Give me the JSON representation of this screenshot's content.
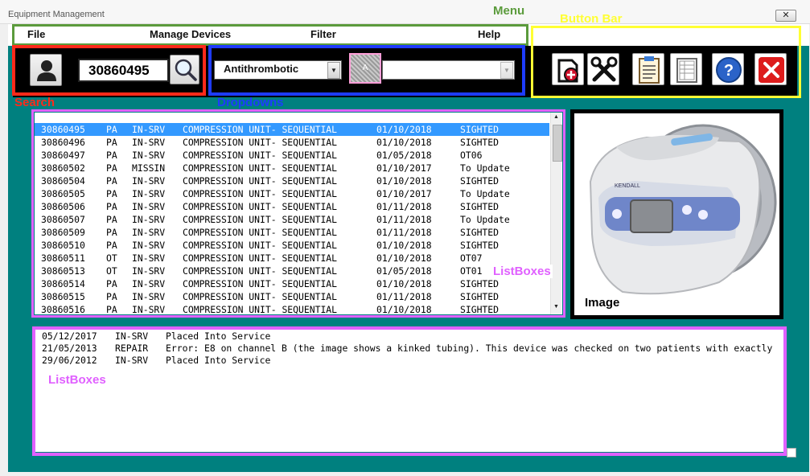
{
  "window": {
    "title": "Equipment Management",
    "close_glyph": "✕"
  },
  "menu": {
    "items": [
      "File",
      "Manage Devices",
      "Filter",
      "Help"
    ]
  },
  "annotations": {
    "menu": "Menu",
    "button_bar": "Button Bar",
    "search": "Search",
    "dropdowns": "Dropdowns",
    "listboxes_top": "ListBoxes",
    "listboxes_bottom": "ListBoxes",
    "image": "Image"
  },
  "colors": {
    "menu": "#5b9b3c",
    "button_bar": "#ffff33",
    "search": "#ff2a1a",
    "dropdowns": "#1e3cff",
    "listboxes": "#e060ff",
    "teal": "#00807f"
  },
  "search": {
    "value": "30860495",
    "user_icon": "user-icon",
    "search_icon": "magnifier-icon"
  },
  "dropdowns": {
    "category": "Antithrombotic",
    "secondary_value": "",
    "mid_label": "A"
  },
  "button_bar": {
    "buttons": [
      {
        "name": "add-device-button",
        "icon": "device-add-icon"
      },
      {
        "name": "tools-button",
        "icon": "tools-icon"
      },
      {
        "name": "clipboard-button",
        "icon": "clipboard-icon"
      },
      {
        "name": "report-button",
        "icon": "report-icon"
      },
      {
        "name": "help-button",
        "icon": "help-icon",
        "glyph": "?"
      },
      {
        "name": "close-button",
        "icon": "close-icon"
      }
    ]
  },
  "devices": {
    "selected_index": 0,
    "rows": [
      [
        "30860495",
        "PA",
        "IN-SRV",
        "COMPRESSION UNIT- SEQUENTIAL",
        "01/10/2018",
        "SIGHTED"
      ],
      [
        "30860496",
        "PA",
        "IN-SRV",
        "COMPRESSION UNIT- SEQUENTIAL",
        "01/10/2018",
        "SIGHTED"
      ],
      [
        "30860497",
        "PA",
        "IN-SRV",
        "COMPRESSION UNIT- SEQUENTIAL",
        "01/05/2018",
        "OT06"
      ],
      [
        "30860502",
        "PA",
        "MISSIN",
        "COMPRESSION UNIT- SEQUENTIAL",
        "01/10/2017",
        "To Update"
      ],
      [
        "30860504",
        "PA",
        "IN-SRV",
        "COMPRESSION UNIT- SEQUENTIAL",
        "01/10/2018",
        "SIGHTED"
      ],
      [
        "30860505",
        "PA",
        "IN-SRV",
        "COMPRESSION UNIT- SEQUENTIAL",
        "01/10/2017",
        "To Update"
      ],
      [
        "30860506",
        "PA",
        "IN-SRV",
        "COMPRESSION UNIT- SEQUENTIAL",
        "01/11/2018",
        "SIGHTED"
      ],
      [
        "30860507",
        "PA",
        "IN-SRV",
        "COMPRESSION UNIT- SEQUENTIAL",
        "01/11/2018",
        "To Update"
      ],
      [
        "30860509",
        "PA",
        "IN-SRV",
        "COMPRESSION UNIT- SEQUENTIAL",
        "01/11/2018",
        "SIGHTED"
      ],
      [
        "30860510",
        "PA",
        "IN-SRV",
        "COMPRESSION UNIT- SEQUENTIAL",
        "01/10/2018",
        "SIGHTED"
      ],
      [
        "30860511",
        "OT",
        "IN-SRV",
        "COMPRESSION UNIT- SEQUENTIAL",
        "01/10/2018",
        "OT07"
      ],
      [
        "30860513",
        "OT",
        "IN-SRV",
        "COMPRESSION UNIT- SEQUENTIAL",
        "01/05/2018",
        "OT01"
      ],
      [
        "30860514",
        "PA",
        "IN-SRV",
        "COMPRESSION UNIT- SEQUENTIAL",
        "01/10/2018",
        "SIGHTED"
      ],
      [
        "30860515",
        "PA",
        "IN-SRV",
        "COMPRESSION UNIT- SEQUENTIAL",
        "01/11/2018",
        "SIGHTED"
      ],
      [
        "30860516",
        "PA",
        "IN-SRV",
        "COMPRESSION UNIT- SEQUENTIAL",
        "01/10/2018",
        "SIGHTED"
      ]
    ]
  },
  "history": {
    "rows": [
      [
        "05/12/2017",
        "IN-SRV",
        "Placed Into Service"
      ],
      [
        "21/05/2013",
        "REPAIR",
        "Error: E8 on channel B (the image shows a kinked tubing). This device was checked on two patients with exactly"
      ],
      [
        "29/06/2012",
        "IN-SRV",
        "Placed Into Service"
      ]
    ]
  },
  "image_panel": {
    "caption": "Image"
  },
  "device_photo": {
    "brand_label": "KENDALL"
  }
}
